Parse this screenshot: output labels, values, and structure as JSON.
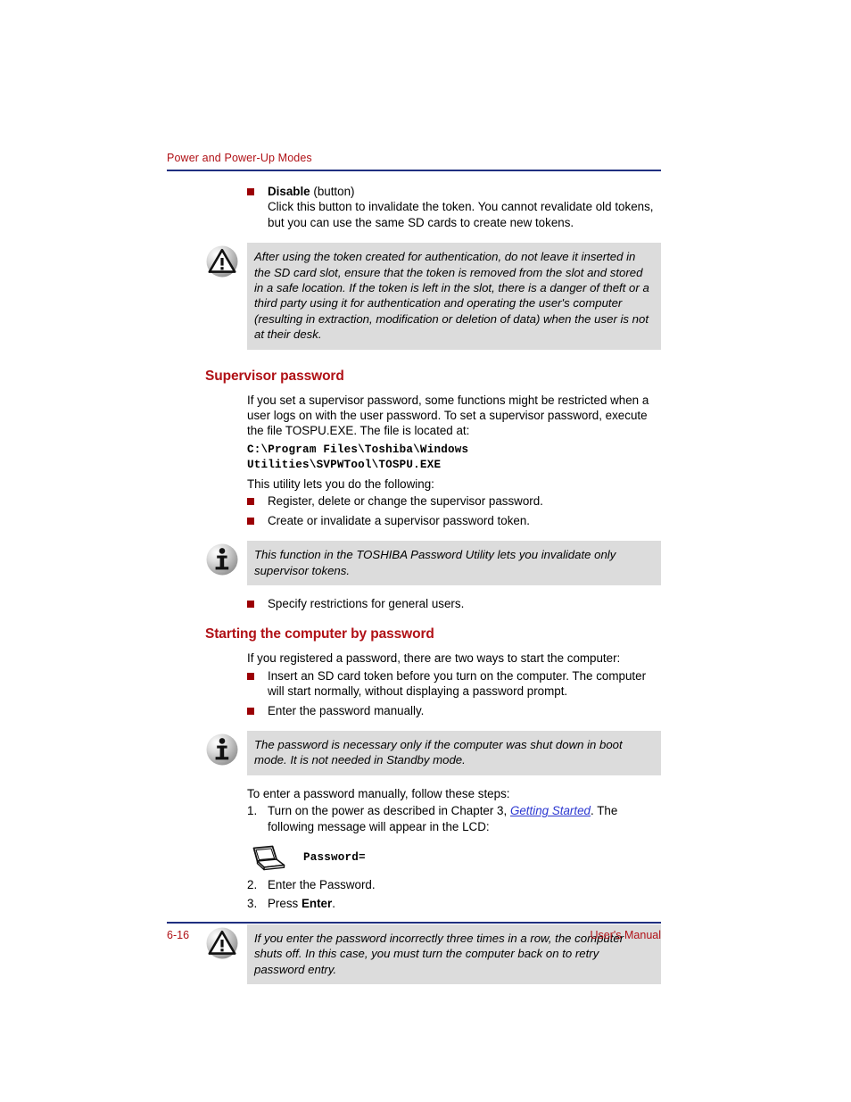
{
  "header": {
    "title": "Power and Power-Up Modes"
  },
  "intro_list": [
    {
      "term": "Disable",
      "term_suffix": " (button)",
      "text": "Click this button to invalidate the token. You cannot revalidate old tokens, but you can use the same SD cards to create new tokens."
    }
  ],
  "warning_1": {
    "icon": "warning-triangle-icon",
    "text": "After using the token created for authentication, do not leave it inserted in the SD card slot, ensure that the token is removed from the slot and stored in a safe location. If the token is left in the slot, there is a danger of theft or a third party using it for authentication and operating the user's computer (resulting in extraction, modification or deletion of data) when the user is not at their desk."
  },
  "section_supervisor": {
    "heading": "Supervisor password",
    "paragraph": "If you set a supervisor password, some functions might be restricted when a user logs on with the user password. To set a supervisor password, execute the file TOSPU.EXE. The file is located at:",
    "path": "C:\\Program Files\\Toshiba\\Windows\nUtilities\\SVPWTool\\TOSPU.EXE",
    "lead_in": "This utility lets you do the following:",
    "bullets": [
      "Register, delete or change the supervisor password.",
      "Create or invalidate a supervisor password token."
    ],
    "bullets_after": [
      "Specify restrictions for general users."
    ]
  },
  "info_1": {
    "icon": "info-circle-icon",
    "text": "This function in the TOSHIBA Password Utility lets you invalidate only supervisor tokens."
  },
  "section_starting": {
    "heading": "Starting the computer by password",
    "paragraph": "If you registered a password, there are two ways to start the computer:",
    "bullets": [
      "Insert an SD card token before you turn on the computer. The computer will start normally, without displaying a password prompt.",
      "Enter the password manually."
    ]
  },
  "info_2": {
    "icon": "info-circle-icon",
    "text": "The password is necessary only if the computer was shut down in boot mode. It is not needed in Standby mode."
  },
  "steps": {
    "lead_in": "To enter a password manually, follow these steps:",
    "items": [
      {
        "number": "1.",
        "text_before": "Turn on the power as described in Chapter 3, ",
        "link": "Getting Started",
        "text_after": ". The following message will appear in the LCD:"
      },
      {
        "number": "2.",
        "text": "Enter the Password."
      },
      {
        "number": "3.",
        "text_before": "Press ",
        "bold": "Enter",
        "text_after": "."
      }
    ]
  },
  "figure": {
    "icon": "laptop-icon",
    "label": "Password="
  },
  "warning_2": {
    "icon": "warning-triangle-icon",
    "text": "If you enter the password incorrectly three times in a row, the computer shuts off. In this case, you must turn the computer back on to retry password entry."
  },
  "footer": {
    "page_number": "6-16",
    "manual_label": "User's Manual"
  },
  "colors": {
    "heading_red": "#B01116",
    "bullet_red": "#9B0004",
    "rule_navy": "#1F2F80",
    "callout_gray": "#DCDCDC",
    "link_blue": "#2B37D0"
  }
}
